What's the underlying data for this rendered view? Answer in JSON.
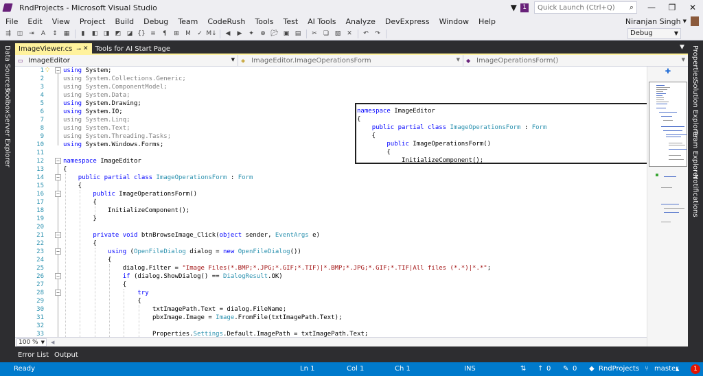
{
  "window": {
    "title": "RndProjects - Microsoft Visual Studio",
    "notification_count": "1",
    "quick_launch_placeholder": "Quick Launch (Ctrl+Q)"
  },
  "menu": {
    "items": [
      "File",
      "Edit",
      "View",
      "Project",
      "Build",
      "Debug",
      "Team",
      "CodeRush",
      "Tools",
      "Test",
      "AI Tools",
      "Analyze",
      "DevExpress",
      "Window",
      "Help"
    ],
    "user_name": "Niranjan Singh"
  },
  "toolbar": {
    "configuration": "Debug"
  },
  "left_tool_tabs": [
    "Data Sources",
    "Toolbox",
    "Server Explorer"
  ],
  "right_tool_tabs": [
    "Properties",
    "Solution Explorer",
    "Team Explorer",
    "Notifications"
  ],
  "document_tabs": [
    {
      "label": "ImageViewer.cs",
      "active": true
    },
    {
      "label": "Tools for AI Start Page",
      "active": false
    }
  ],
  "navigation": {
    "project": "ImageEditor",
    "type": "ImageEditor.ImageOperationsForm",
    "member": "ImageOperationsForm()"
  },
  "editor": {
    "line_numbers": [
      "1",
      "2",
      "3",
      "4",
      "5",
      "6",
      "7",
      "8",
      "9",
      "10",
      "11",
      "12",
      "13",
      "14",
      "15",
      "16",
      "17",
      "18",
      "19",
      "20",
      "21",
      "22",
      "23",
      "24",
      "25",
      "26",
      "27",
      "28",
      "29",
      "30",
      "31",
      "32",
      "33"
    ],
    "zoom": "100 %"
  },
  "bottom_tabs": [
    "Error List",
    "Output"
  ],
  "status": {
    "state": "Ready",
    "line": "Ln 1",
    "col": "Col 1",
    "ch": "Ch 1",
    "mode": "INS",
    "up_count": "0",
    "edit_count": "0",
    "repo": "RndProjects",
    "branch": "master",
    "notifications": "1"
  },
  "colors": {
    "accent": "#007acc",
    "active_tab": "#fff29d",
    "keyword": "#0000ff",
    "type": "#2b91af",
    "string": "#a31515"
  }
}
